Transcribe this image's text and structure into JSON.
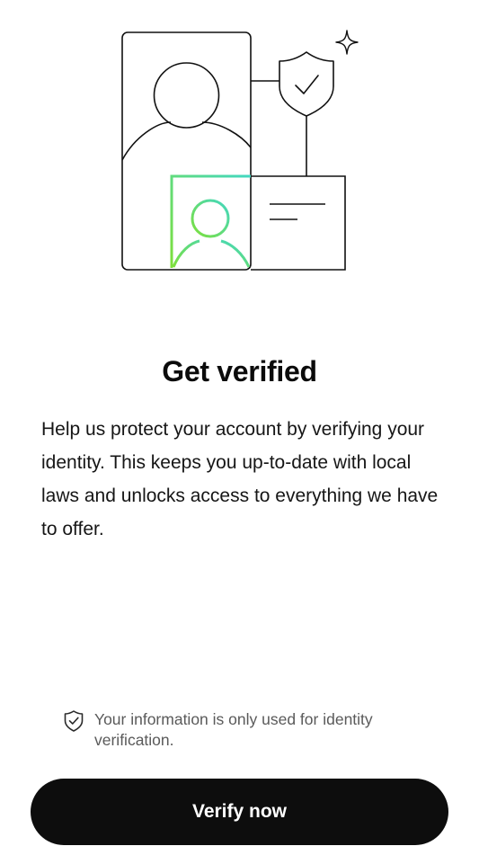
{
  "screen": {
    "title": "Get verified",
    "description": "Help us protect your account by verifying your identity. This keeps you up-to-date with local laws and unlocks access to everything we have to offer."
  },
  "privacy_notice": {
    "icon": "shield-check-icon",
    "text": "Your information is only used for identity verification."
  },
  "primary_action": {
    "label": "Verify now"
  },
  "colors": {
    "button_background": "#0d0d0d",
    "button_text": "#ffffff",
    "accent_gradient_start": "#7ee03a",
    "accent_gradient_end": "#42d7c1"
  }
}
